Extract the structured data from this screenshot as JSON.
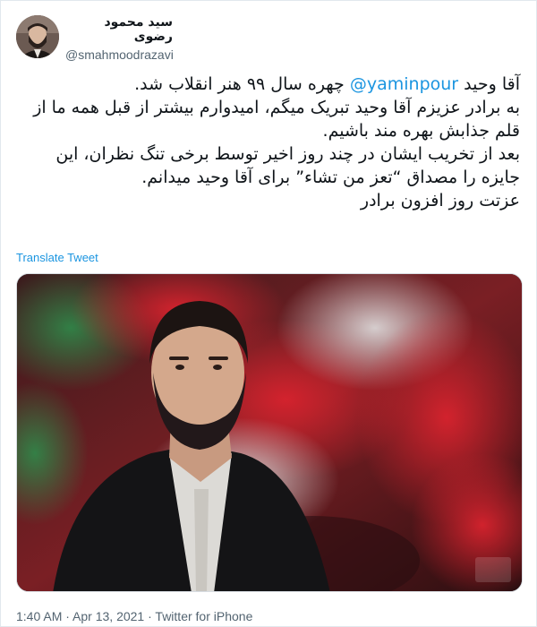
{
  "user": {
    "display_name": "سید محمود رضوی",
    "handle": "@smahmoodrazavi"
  },
  "tweet": {
    "line1_prefix": "آقا وحید",
    "mention": "@yaminpour",
    "line1_suffix": "چهره سال ۹۹ هنر انقلاب شد.",
    "line2": "به برادر عزیزم آقا وحید تبریک میگم، امیدوارم بیشتر از قبل همه ما از قلم جذابش بهره مند باشیم.",
    "line3": "بعد از تخریب ایشان در چند روز اخیر توسط برخی تنگ نظران، این جایزه را مصداق “تعز من تشاء” برای آقا وحید میدانم.",
    "line4": "عزتت روز افزون برادر"
  },
  "translate_label": "Translate Tweet",
  "more_icon": "more-icon",
  "meta": {
    "time": "1:40 AM",
    "separator": " · ",
    "date": "Apr 13, 2021",
    "source": "Twitter for iPhone"
  },
  "colors": {
    "link": "#1b95e0",
    "text": "#0f1419",
    "muted": "#536471",
    "border": "#e1e8ed"
  }
}
